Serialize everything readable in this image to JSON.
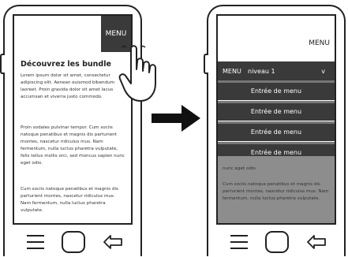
{
  "left_screen": {
    "menu_button": "MENU",
    "heading": "Découvrez les bundle",
    "paragraphs": [
      "Lorem ipsum dolor sit amet, consectetur adipiscing elit. Aenean euismod bibendum laoreet. Proin gravida dolor sit amet lacus accumsan et viverra justo commodo.",
      "Proin sodales pulvinar tempor. Cum sociis natoque penatibus et magnis dis parturient montes, nascetur ridiculus mus. Nam fermentum, nulla luctus pharetra vulputate, felis tellus mollis orci, sed rhoncus sapien nunc eget odio.",
      "Cum sociis natoque penatibus et magnis dis parturient montes, nascetur ridiculus mus. Nam fermentum, nulla luctus pharetra vulputate."
    ]
  },
  "right_screen": {
    "menu_label": "MENU",
    "menu_bar": {
      "menu": "MENU",
      "level": "niveau 1",
      "chevron": "v"
    },
    "menu_items": [
      "Entrée de menu",
      "Entrée de menu",
      "Entrée de menu",
      "Entrée de menu"
    ],
    "paragraph_top": "nunc eget odio.",
    "paragraph_bottom": "Cum sociis natoque penatibus et magnis dis parturient montes, nascetur ridiculus mus. Nam fermentum, nulla luctus pharetra vulputate."
  },
  "icons": {
    "hand": "pointing-hand-icon",
    "arrow": "right-arrow-icon",
    "menu": "hamburger-icon",
    "home": "home-button-icon",
    "back": "back-arrow-icon"
  },
  "colors": {
    "menu_dark": "#3a3a3a",
    "overlay": "#8d8d8d"
  }
}
